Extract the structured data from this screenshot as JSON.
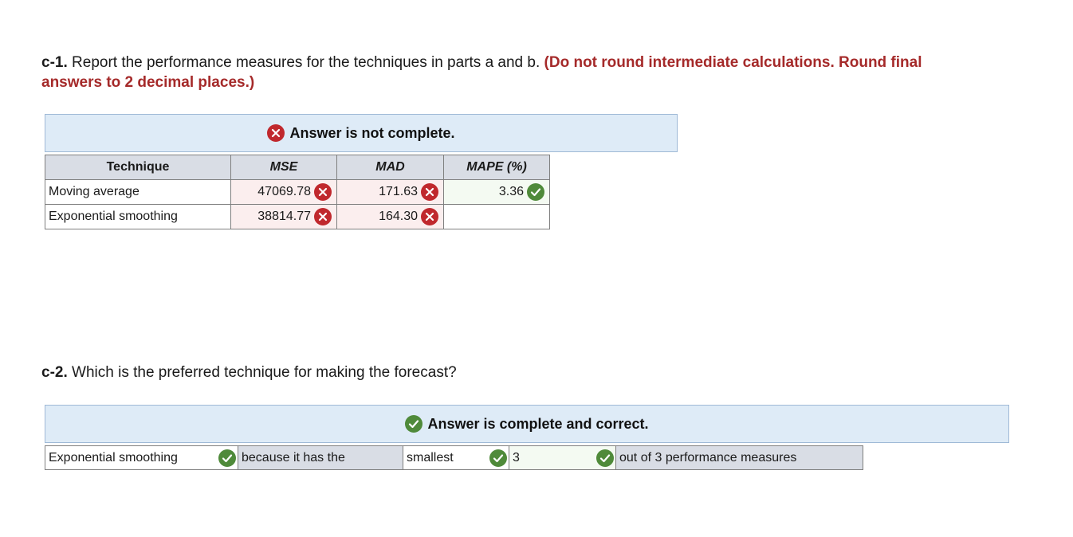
{
  "c1": {
    "label": "c-1.",
    "question": " Report the performance measures for the techniques in parts a and b.",
    "hint_line1": " (Do not round intermediate calculations. Round final",
    "hint_line2": "answers to 2 decimal places.)",
    "banner": "Answer is not complete.",
    "table": {
      "headers": [
        "Technique",
        "MSE",
        "MAD",
        "MAPE (%)"
      ],
      "rows": [
        {
          "technique": "Moving average",
          "mse": "47069.78",
          "mse_status": "incorrect",
          "mad": "171.63",
          "mad_status": "incorrect",
          "mape": "3.36",
          "mape_status": "correct"
        },
        {
          "technique": "Exponential smoothing",
          "mse": "38814.77",
          "mse_status": "incorrect",
          "mad": "164.30",
          "mad_status": "incorrect",
          "mape": "",
          "mape_status": "none"
        }
      ]
    }
  },
  "c2": {
    "label": "c-2.",
    "question": " Which is the preferred technique for making the forecast?",
    "banner": "Answer is complete and correct.",
    "answer": {
      "technique": "Exponential smoothing",
      "connector": "because it has the",
      "comparison": "smallest",
      "count": "3",
      "tail": "out of 3 performance measures"
    }
  },
  "colors": {
    "incorrect": "#c0282d",
    "correct": "#4f8a3a",
    "hint": "#a52a2a",
    "banner_bg": "#deebf7",
    "header_bg": "#d9dde5"
  },
  "icons": {
    "incorrect": "x-circle-icon",
    "correct": "check-circle-icon"
  }
}
